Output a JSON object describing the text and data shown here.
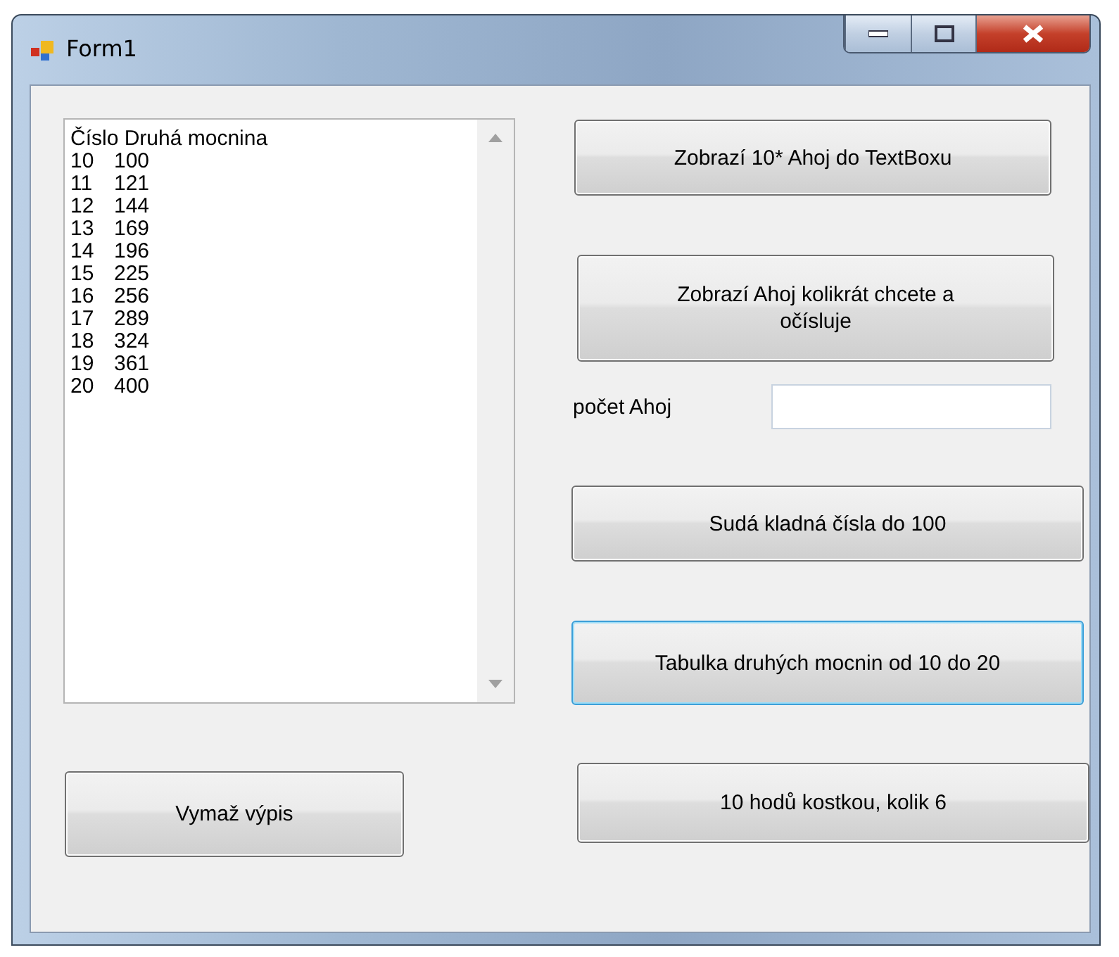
{
  "window": {
    "title": "Form1"
  },
  "listbox": {
    "header": "Číslo Druhá mocnina",
    "rows": [
      {
        "number": "10",
        "square": "100"
      },
      {
        "number": "11",
        "square": "121"
      },
      {
        "number": "12",
        "square": "144"
      },
      {
        "number": "13",
        "square": "169"
      },
      {
        "number": "14",
        "square": "196"
      },
      {
        "number": "15",
        "square": "225"
      },
      {
        "number": "16",
        "square": "256"
      },
      {
        "number": "17",
        "square": "289"
      },
      {
        "number": "18",
        "square": "324"
      },
      {
        "number": "19",
        "square": "361"
      },
      {
        "number": "20",
        "square": "400"
      }
    ]
  },
  "buttons": [
    {
      "label": "Zobrazí 10* Ahoj do TextBoxu",
      "focused": false
    },
    {
      "label": "Zobrazí Ahoj kolikrát chcete a očísluje",
      "focused": false
    },
    {
      "label": "Sudá kladná čísla do 100",
      "focused": false
    },
    {
      "label": "Tabulka druhých mocnin od 10 do 20",
      "focused": true
    },
    {
      "label": "10 hodů kostkou, kolik 6",
      "focused": false
    }
  ],
  "count_field": {
    "label": "počet Ahoj"
  },
  "clear_button": {
    "label": "Vymaž výpis",
    "focused": false
  }
}
